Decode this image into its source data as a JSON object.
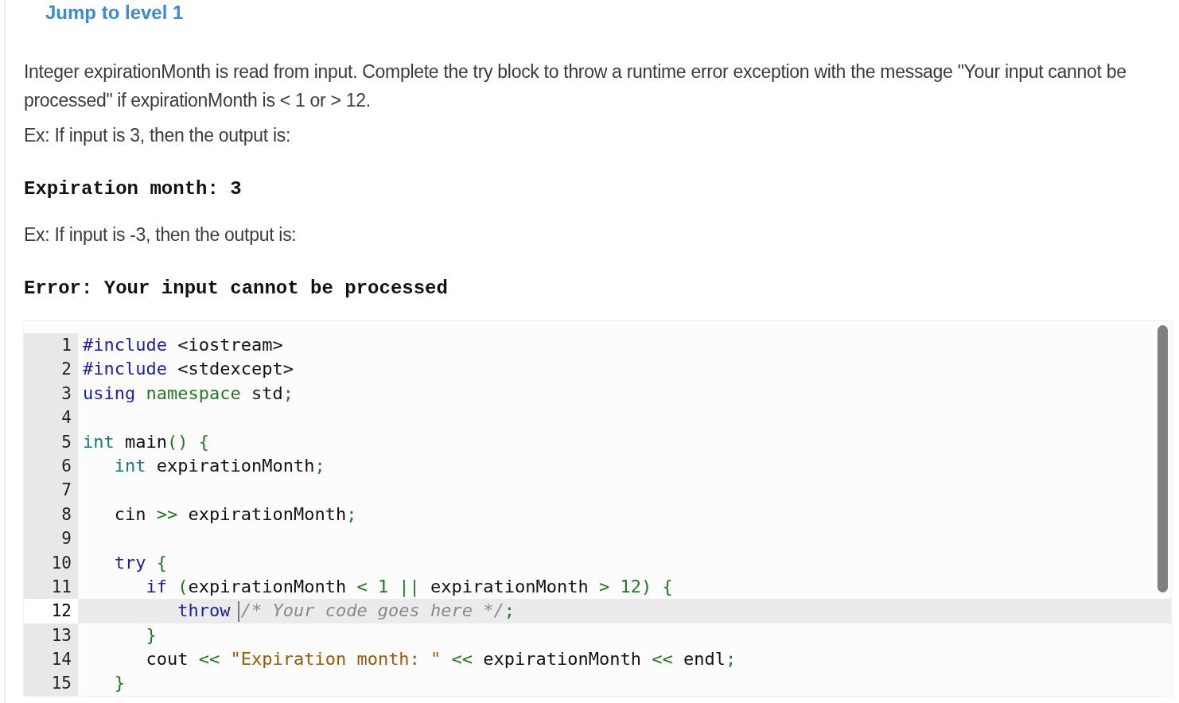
{
  "title": "Jump to level 1",
  "paragraphs": [
    {
      "kind": "text",
      "text": "Integer expirationMonth is read from input. Complete the try block to throw a runtime error exception with the message \"Your input cannot be processed\" if expirationMonth is < 1 or > 12."
    },
    {
      "kind": "text",
      "text": "Ex: If input is 3, then the output is:"
    },
    {
      "kind": "output",
      "text": "Expiration month: 3"
    },
    {
      "kind": "text",
      "text": "Ex: If input is -3, then the output is:"
    },
    {
      "kind": "output",
      "text": "Error: Your input cannot be processed"
    }
  ],
  "editor": {
    "lines": [
      {
        "number": "1",
        "selected": false,
        "tokens": [
          {
            "kind": "keyword",
            "text": "#include"
          },
          {
            "kind": "plain",
            "text": " <iostream>"
          }
        ]
      },
      {
        "number": "2",
        "selected": false,
        "tokens": [
          {
            "kind": "keyword",
            "text": "#include"
          },
          {
            "kind": "plain",
            "text": " <stdexcept>"
          }
        ]
      },
      {
        "number": "3",
        "selected": false,
        "tokens": [
          {
            "kind": "keyword",
            "text": "using"
          },
          {
            "kind": "green",
            "text": " namespace"
          },
          {
            "kind": "plain",
            "text": " std"
          },
          {
            "kind": "green",
            "text": ";"
          }
        ]
      },
      {
        "number": "4",
        "selected": false
      },
      {
        "number": "5",
        "selected": false,
        "tokens": [
          {
            "kind": "type",
            "text": "int"
          },
          {
            "kind": "plain",
            "text": " main"
          },
          {
            "kind": "green",
            "text": "() {"
          }
        ]
      },
      {
        "number": "6",
        "selected": false,
        "tokens": [
          {
            "kind": "type",
            "text": "   int"
          },
          {
            "kind": "plain",
            "text": " expirationMonth"
          },
          {
            "kind": "green",
            "text": ";"
          }
        ]
      },
      {
        "number": "7",
        "selected": false
      },
      {
        "number": "8",
        "selected": false,
        "tokens": [
          {
            "kind": "plain",
            "text": "   cin "
          },
          {
            "kind": "green",
            "text": ">>"
          },
          {
            "kind": "plain",
            "text": " expirationMonth"
          },
          {
            "kind": "green",
            "text": ";"
          }
        ]
      },
      {
        "number": "9",
        "selected": false
      },
      {
        "number": "10",
        "selected": false,
        "tokens": [
          {
            "kind": "keyword",
            "text": "   try"
          },
          {
            "kind": "green",
            "text": " {"
          }
        ]
      },
      {
        "number": "11",
        "selected": false,
        "tokens": [
          {
            "kind": "keyword",
            "text": "      if"
          },
          {
            "kind": "green",
            "text": " ("
          },
          {
            "kind": "plain",
            "text": "expirationMonth "
          },
          {
            "kind": "green",
            "text": "< 1 ||"
          },
          {
            "kind": "plain",
            "text": " expirationMonth "
          },
          {
            "kind": "green",
            "text": "> 12) {"
          }
        ]
      },
      {
        "number": "12",
        "selected": true,
        "tokens": [
          {
            "kind": "keyword",
            "text": "         throw "
          },
          {
            "kind": "cursor"
          },
          {
            "kind": "comment",
            "text": "/* Your code goes here */"
          },
          {
            "kind": "green",
            "text": ";"
          }
        ]
      },
      {
        "number": "13",
        "selected": false,
        "tokens": [
          {
            "kind": "green",
            "text": "      }"
          }
        ]
      },
      {
        "number": "14",
        "selected": false,
        "tokens": [
          {
            "kind": "plain",
            "text": "      cout "
          },
          {
            "kind": "green",
            "text": "<<"
          },
          {
            "kind": "string",
            "text": " \"Expiration month: \""
          },
          {
            "kind": "green",
            "text": " <<"
          },
          {
            "kind": "plain",
            "text": " expirationMonth "
          },
          {
            "kind": "green",
            "text": "<<"
          },
          {
            "kind": "plain",
            "text": " endl"
          },
          {
            "kind": "green",
            "text": ";"
          }
        ]
      },
      {
        "number": "15",
        "selected": false,
        "tokens": [
          {
            "kind": "green",
            "text": "   }"
          }
        ]
      }
    ]
  }
}
